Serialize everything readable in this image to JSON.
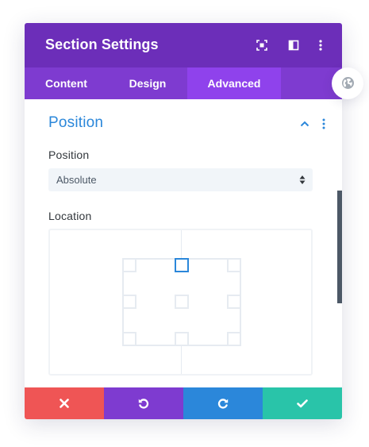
{
  "window": {
    "title": "Section Settings"
  },
  "header_icons": [
    "expand-icon",
    "split-view-icon",
    "more-options-icon"
  ],
  "tabs": [
    {
      "label": "Content",
      "active": false
    },
    {
      "label": "Design",
      "active": false
    },
    {
      "label": "Advanced",
      "active": true
    }
  ],
  "section": {
    "title": "Position",
    "icons": [
      "chevron-up-icon",
      "section-more-icon"
    ]
  },
  "position_field": {
    "label": "Position",
    "value": "Absolute",
    "icon": "select-arrows-icon"
  },
  "location_field": {
    "label": "Location",
    "grid": [
      "top-left",
      "top-center",
      "top-right",
      "center-left",
      "center",
      "center-right",
      "bottom-left",
      "bottom-center",
      "bottom-right"
    ],
    "selected": "top-center"
  },
  "footer": {
    "buttons": [
      {
        "name": "cancel",
        "icon": "close-icon",
        "color": "#ef5555"
      },
      {
        "name": "undo",
        "icon": "undo-icon",
        "color": "#7e3bd0"
      },
      {
        "name": "redo",
        "icon": "redo-icon",
        "color": "#2b87da"
      },
      {
        "name": "save",
        "icon": "check-icon",
        "color": "#29c4a9"
      }
    ]
  },
  "side_button": {
    "icon": "globe-icon"
  },
  "colors": {
    "header": "#6c2eb9",
    "tabs": "#7e3bd0",
    "active_tab": "#8f42ec",
    "accent_blue": "#2b87da",
    "text": "#32373c"
  }
}
